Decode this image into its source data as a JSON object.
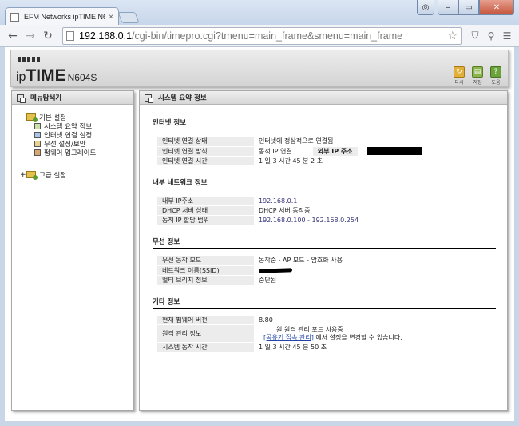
{
  "browser": {
    "tab_title": "EFM Networks ipTIME N6",
    "tab_close": "×",
    "url_host": "192.168.0.1",
    "url_path": "/cgi-bin/timepro.cgi?tmenu=main_frame&smenu=main_frame",
    "window_user": "◎",
    "window_min": "–",
    "window_max": "▭",
    "window_close": "✕"
  },
  "header": {
    "logo_ip": "ip",
    "logo_time": "TIME",
    "logo_model": "N604S",
    "tools": [
      {
        "label": "다시",
        "icon": "refresh-icon"
      },
      {
        "label": "저장",
        "icon": "save-icon"
      },
      {
        "label": "도움",
        "icon": "help-icon"
      }
    ]
  },
  "left_panel": {
    "title": "메뉴탐색기",
    "basic_group": "기본 설정",
    "basic_items": [
      "시스템 요약 정보",
      "인터넷 연결 설정",
      "무선 설정/보안",
      "펌웨어 업그레이드"
    ],
    "advanced_expander": "+",
    "advanced_group": "고급 설정"
  },
  "right_panel": {
    "title": "시스템 요약 정보",
    "internet": {
      "title": "인터넷 정보",
      "status_label": "인터넷 연결 상태",
      "status_value": "인터넷에 정상적으로 연결됨",
      "method_label": "인터넷 연결 방식",
      "method_value": "동적 IP 연결",
      "external_ip_label": "외부 IP 주소",
      "time_label": "인터넷 연결 시간",
      "time_value": "1 일 3 시간 45 분 2 초"
    },
    "lan": {
      "title": "내부 네트워크 정보",
      "ip_label": "내부 IP주소",
      "ip_value": "192.168.0.1",
      "dhcp_label": "DHCP 서버 상태",
      "dhcp_value": "DHCP 서버 동작중",
      "range_label": "동적 IP 할당 범위",
      "range_value": "192.168.0.100 - 192.168.0.254"
    },
    "wireless": {
      "title": "무선 정보",
      "mode_label": "무선 동작 모드",
      "mode_value": "동작중 - AP 모드 - 암호화 사용",
      "ssid_label": "네트워크 이름(SSID)",
      "bridge_label": "멀티 브리지 정보",
      "bridge_value": "중단됨"
    },
    "other": {
      "title": "기타 정보",
      "fw_label": "현재 펌웨어 버전",
      "fw_value": "8.80",
      "remote_label": "원격 관리 정보",
      "remote_value": "원 원격 관리 포트 사용중",
      "remote_link": "[공유기 접속 관리]",
      "remote_suffix": " 에서 설정을 변경할 수 있습니다.",
      "uptime_label": "시스템 동작 시간",
      "uptime_value": "1 일 3 시간 45 분 50 초"
    }
  }
}
